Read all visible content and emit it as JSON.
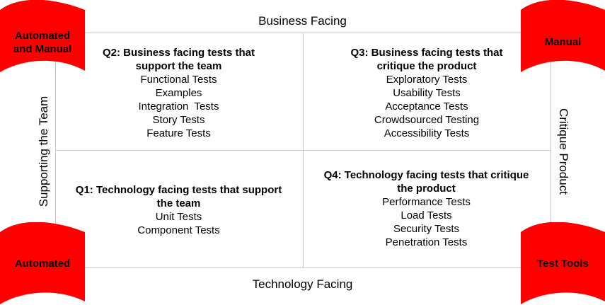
{
  "axes": {
    "top": "Business Facing",
    "bottom": "Technology Facing",
    "left": "Supporting the Team",
    "right": "Critique Product"
  },
  "quadrants": {
    "q2": {
      "title": [
        "Q2: Business facing tests that",
        "support the team"
      ],
      "items": [
        "Functional Tests",
        "Examples",
        "Integration  Tests",
        "Story Tests",
        "Feature Tests"
      ]
    },
    "q3": {
      "title": [
        "Q3: Business facing tests that",
        "critique the product"
      ],
      "items": [
        "Exploratory Tests",
        "Usability Tests",
        "Acceptance Tests",
        "Crowdsourced Testing",
        "Accessibility Tests"
      ]
    },
    "q1": {
      "title": [
        "Q1: Technology facing tests that support",
        "the team"
      ],
      "items": [
        "Unit Tests",
        "Component Tests"
      ]
    },
    "q4": {
      "title": [
        "Q4: Technology facing tests that critique",
        "the product"
      ],
      "items": [
        "Performance Tests",
        "Load Tests",
        "Security Tests",
        "Penetration Tests"
      ]
    }
  },
  "corners": {
    "top_left": [
      "Automated",
      "and Manual"
    ],
    "top_right": [
      "Manual"
    ],
    "bottom_left": [
      "Automated"
    ],
    "bottom_right": [
      "Test Tools"
    ]
  },
  "colors": {
    "banner": "#ff0000",
    "grid": "#c8c8c8"
  }
}
